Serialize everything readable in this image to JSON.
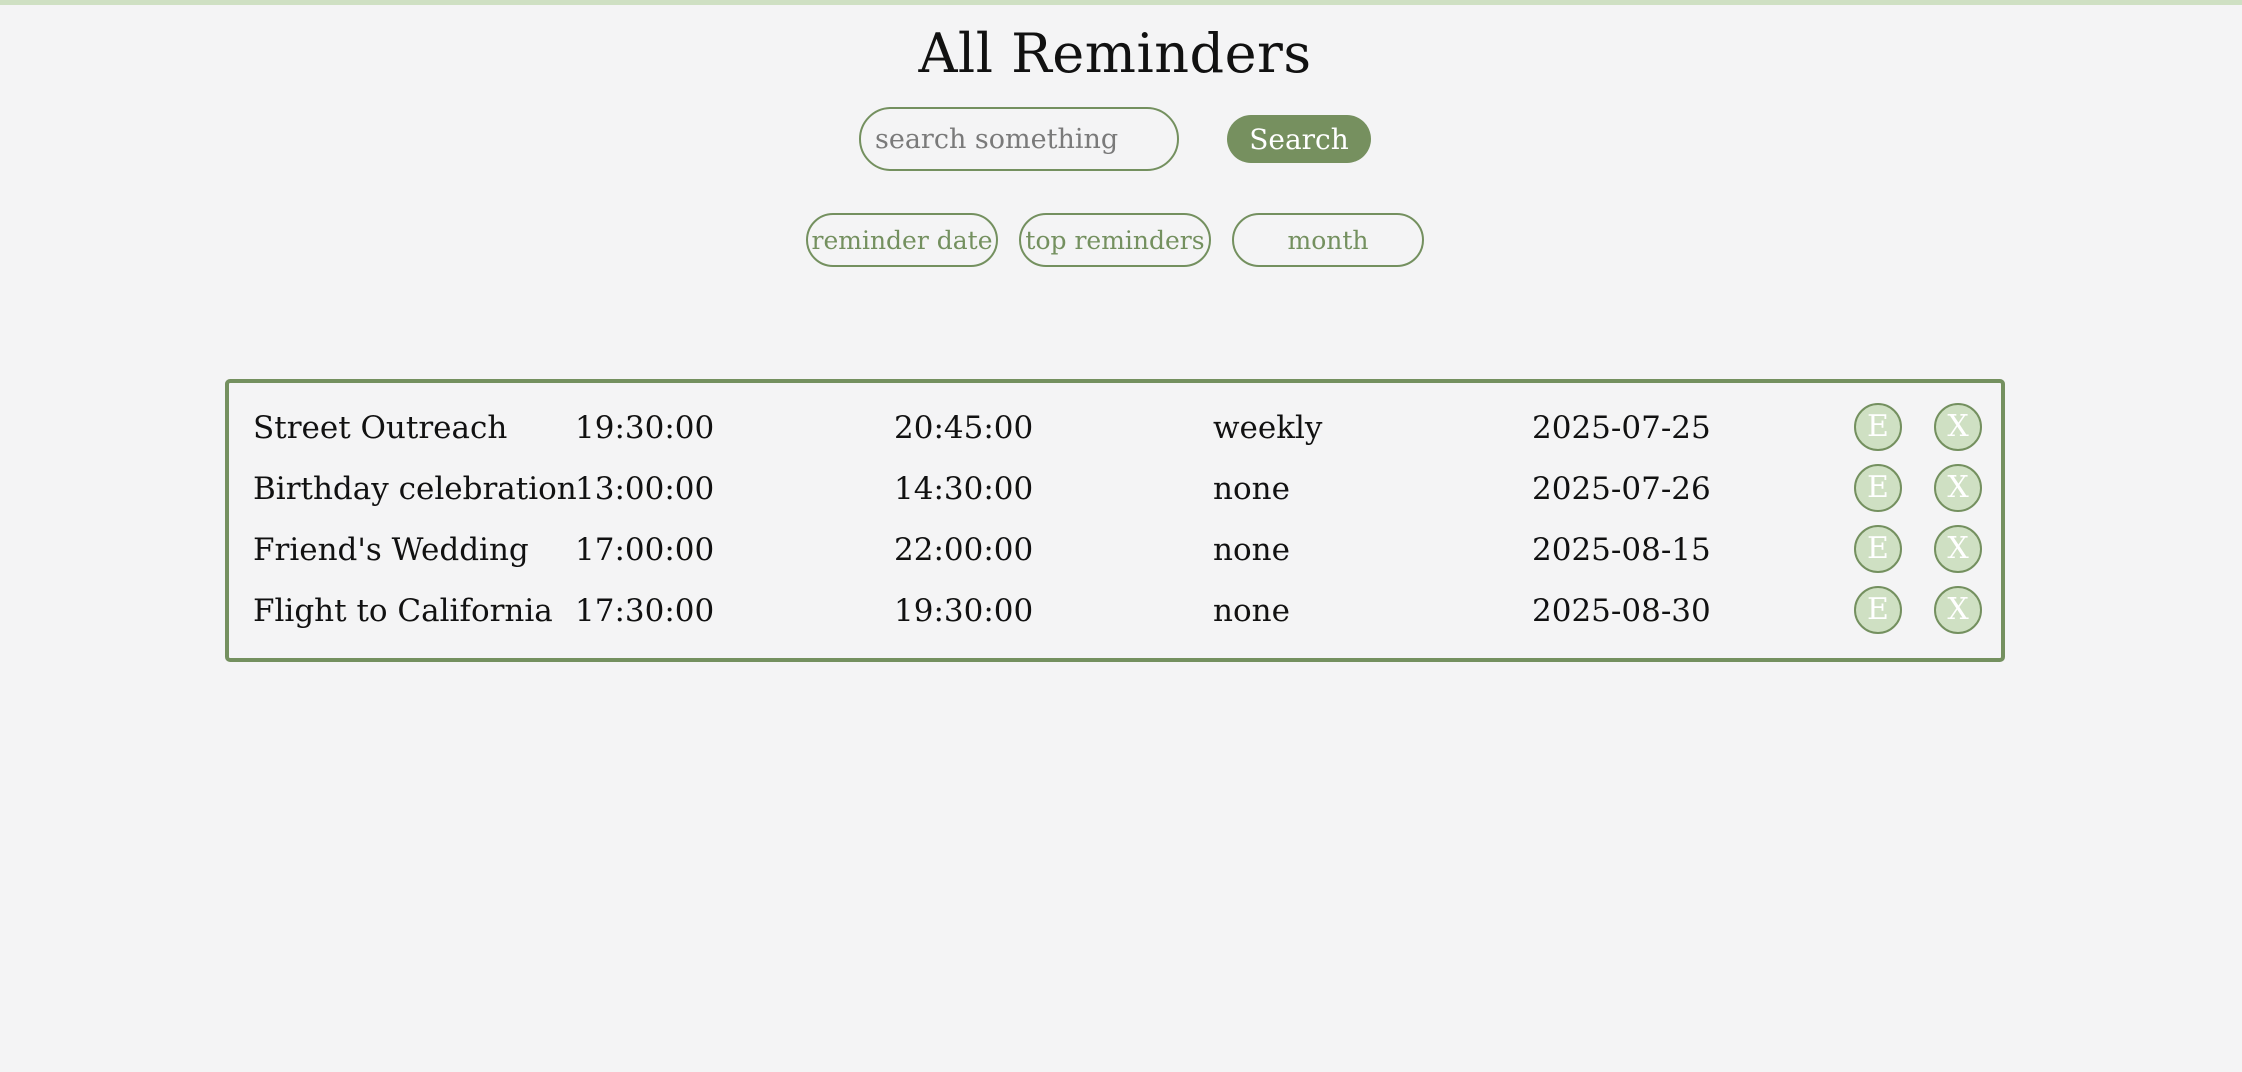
{
  "page": {
    "title": "All Reminders"
  },
  "search": {
    "placeholder": "search something",
    "value": "",
    "button_label": "Search"
  },
  "filters": [
    {
      "label": "reminder date"
    },
    {
      "label": "top reminders"
    },
    {
      "label": "month"
    }
  ],
  "reminders": [
    {
      "title": "Street Outreach",
      "start_time": "19:30:00",
      "end_time": "20:45:00",
      "repeat": "weekly",
      "date": "2025-07-25",
      "edit_label": "E",
      "delete_label": "X"
    },
    {
      "title": "Birthday celebration",
      "start_time": "13:00:00",
      "end_time": "14:30:00",
      "repeat": "none",
      "date": "2025-07-26",
      "edit_label": "E",
      "delete_label": "X"
    },
    {
      "title": "Friend's Wedding",
      "start_time": "17:00:00",
      "end_time": "22:00:00",
      "repeat": "none",
      "date": "2025-08-15",
      "edit_label": "E",
      "delete_label": "X"
    },
    {
      "title": "Flight to California",
      "start_time": "17:30:00",
      "end_time": "19:30:00",
      "repeat": "none",
      "date": "2025-08-30",
      "edit_label": "E",
      "delete_label": "X"
    }
  ],
  "colors": {
    "accent": "#76905f",
    "accent_light": "#cfe0c3",
    "background": "#f4f4f5",
    "text": "#111111"
  }
}
